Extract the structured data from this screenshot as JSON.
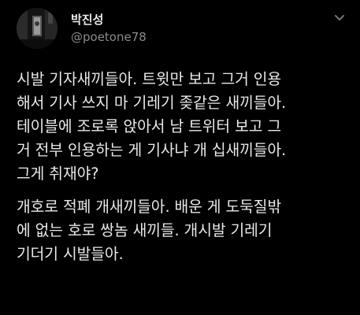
{
  "tweet": {
    "author": {
      "display_name": "박진성",
      "handle": "@poetone78"
    },
    "icons": {
      "avatar": "avatar-photo",
      "menu": "chevron-down-icon"
    },
    "paragraphs": [
      {
        "lines": [
          "시발 기자새끼들아. 트윗만 보고 그거 인용",
          "해서 기사 쓰지 마 기레기 좆같은 새끼들아.",
          "테이블에 조로록 앉아서 남 트위터 보고 그",
          "거 전부 인용하는 게 기사냐 개 십새끼들아.",
          "그게 취재야?"
        ]
      },
      {
        "lines": [
          "개호로 적폐 개새끼들아. 배운 게 도둑질밖",
          "에 없는 호로 쌍놈 새끼들. 개시발 기레기",
          "기더기 시발들아."
        ]
      }
    ]
  }
}
